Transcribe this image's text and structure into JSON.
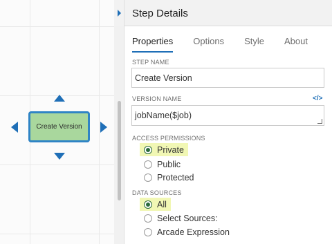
{
  "canvas": {
    "node_label": "Create Version"
  },
  "panel": {
    "title": "Step Details",
    "tabs": [
      "Properties",
      "Options",
      "Style",
      "About"
    ],
    "step_name": {
      "label": "STEP NAME",
      "value": "Create Version"
    },
    "version_name": {
      "label": "VERSION NAME",
      "value": "jobName($job)",
      "code_icon": "</>"
    },
    "access_permissions": {
      "label": "ACCESS PERMISSIONS",
      "options": [
        "Private",
        "Public",
        "Protected"
      ],
      "selected": "Private"
    },
    "data_sources": {
      "label": "DATA SOURCES",
      "options": [
        "All",
        "Select Sources:",
        "Arcade Expression"
      ],
      "selected": "All"
    }
  }
}
